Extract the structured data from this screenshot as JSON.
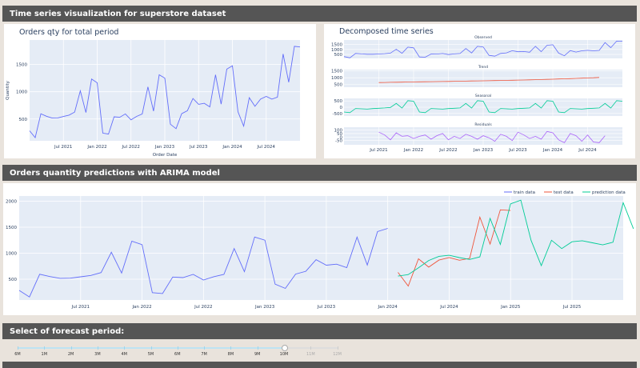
{
  "header1": {
    "title": "Time series visualization for superstore dataset"
  },
  "header2": {
    "title": "Orders quantity predictions with ARIMA model"
  },
  "header3": {
    "title": "Select of forecast period:"
  },
  "colors": {
    "header_bg": "#555555",
    "plot_bg": "#e5ecf6",
    "train": "#636efa",
    "test": "#ef553b",
    "prediction": "#00cc96",
    "trend": "#ef553b",
    "seasonal": "#00cc96",
    "resid": "#ab63fa"
  },
  "slider": {
    "options": [
      "6M",
      "1M",
      "2M",
      "3M",
      "4M",
      "5M",
      "6M",
      "7M",
      "8M",
      "9M",
      "10M",
      "11M",
      "12M"
    ],
    "selected": "10M"
  },
  "chart_data": [
    {
      "type": "line",
      "title": "Orders qty for total period",
      "xlabel": "Order Date",
      "ylabel": "Quantity",
      "x_ticks": [
        "Jul 2021",
        "Jan 2022",
        "Jul 2022",
        "Jan 2023",
        "Jul 2023",
        "Jan 2024",
        "Jul 2024"
      ],
      "y_ticks": [
        500,
        1000,
        1500
      ],
      "ylim": [
        100,
        1950
      ],
      "x_start": "2021-01",
      "x_end": "2024-12",
      "series": [
        {
          "values": [
            284,
            159,
            596,
            551,
            517,
            520,
            546,
            572,
            627,
            1018,
            618,
            1233,
            1165,
            241,
            224,
            541,
            531,
            593,
            485,
            548,
            593,
            1089,
            645,
            1311,
            1251,
            404,
            323,
            598,
            652,
            876,
            769,
            789,
            723,
            1311,
            773,
            1416,
            1477,
            631,
            368,
            892,
            733,
            867,
            915,
            865,
            901,
            1694,
            1175,
            1834,
            1822
          ]
        }
      ]
    },
    {
      "type": "line",
      "title": "Decomposed time series",
      "x_ticks": [
        "Jul 2021",
        "Jan 2022",
        "Jul 2022",
        "Jan 2023",
        "Jul 2023",
        "Jan 2024",
        "Jul 2024"
      ],
      "subplots": [
        {
          "title": "Observed",
          "y_ticks": [
            500,
            1000,
            1500
          ],
          "ylim": [
            100,
            1950
          ],
          "values": [
            284,
            159,
            596,
            551,
            517,
            520,
            546,
            572,
            627,
            1018,
            618,
            1233,
            1165,
            241,
            224,
            541,
            531,
            593,
            485,
            548,
            593,
            1089,
            645,
            1311,
            1251,
            404,
            323,
            598,
            652,
            876,
            769,
            789,
            723,
            1311,
            773,
            1416,
            1477,
            631,
            368,
            892,
            733,
            867,
            915,
            865,
            901,
            1694,
            1175,
            1834,
            1822
          ]
        },
        {
          "title": "Trend",
          "y_ticks": [
            500,
            1000,
            1500
          ],
          "ylim": [
            300,
            1600
          ],
          "values": [
            null,
            null,
            null,
            null,
            null,
            null,
            640,
            650,
            660,
            668,
            675,
            682,
            690,
            695,
            700,
            708,
            714,
            720,
            728,
            735,
            742,
            750,
            758,
            765,
            772,
            780,
            788,
            797,
            806,
            815,
            824,
            834,
            845,
            856,
            867,
            880,
            893,
            906,
            920,
            935,
            950,
            966,
            983,
            1000,
            1020,
            null,
            null,
            null,
            null
          ]
        },
        {
          "title": "Seasonal",
          "y_ticks": [
            -500,
            0,
            500
          ],
          "ylim": [
            -700,
            700
          ],
          "values": [
            -380,
            -430,
            -100,
            -130,
            -150,
            -110,
            -80,
            -60,
            -20,
            300,
            -70,
            520,
            480,
            -380,
            -430,
            -100,
            -130,
            -150,
            -110,
            -80,
            -60,
            300,
            -70,
            520,
            480,
            -380,
            -430,
            -100,
            -130,
            -150,
            -110,
            -80,
            -60,
            300,
            -70,
            520,
            480,
            -380,
            -430,
            -100,
            -130,
            -150,
            -110,
            -80,
            -60,
            300,
            -70,
            520,
            480
          ]
        },
        {
          "title": "Residuals",
          "y_ticks": [
            -50,
            0,
            50,
            100
          ],
          "ylim": [
            -110,
            140
          ],
          "values": [
            null,
            null,
            null,
            null,
            null,
            null,
            70,
            30,
            -40,
            60,
            10,
            20,
            -20,
            10,
            30,
            -30,
            20,
            50,
            -40,
            10,
            -20,
            40,
            10,
            -30,
            20,
            -10,
            -60,
            40,
            10,
            -50,
            70,
            30,
            -20,
            10,
            -30,
            80,
            60,
            -40,
            -80,
            50,
            20,
            -60,
            30,
            -70,
            -80,
            20,
            null,
            null,
            null
          ]
        }
      ]
    },
    {
      "type": "line",
      "x_ticks": [
        "Jul 2021",
        "Jan 2022",
        "Jul 2022",
        "Jan 2023",
        "Jul 2023",
        "Jan 2024",
        "Jul 2024",
        "Jan 2025",
        "Jul 2025"
      ],
      "y_ticks": [
        500,
        1000,
        1500,
        2000
      ],
      "ylim": [
        100,
        2100
      ],
      "legend": "top-right",
      "series": [
        {
          "name": "train data",
          "values": [
            284,
            159,
            596,
            551,
            517,
            520,
            546,
            572,
            627,
            1018,
            618,
            1233,
            1165,
            241,
            224,
            541,
            531,
            593,
            485,
            548,
            593,
            1089,
            645,
            1311,
            1251,
            404,
            323,
            598,
            652,
            876,
            769,
            789,
            723,
            1311,
            773,
            1416,
            1477
          ]
        },
        {
          "name": "test data",
          "values": [
            631,
            368,
            892,
            733,
            867,
            915,
            865,
            901,
            1694,
            1175,
            1834,
            1822
          ]
        },
        {
          "name": "prediction data",
          "values": [
            560,
            590,
            720,
            860,
            940,
            960,
            915,
            880,
            930,
            1670,
            1170,
            1950,
            2020,
            1250,
            760,
            1250,
            1090,
            1220,
            1240,
            1200,
            1160,
            1210,
            1970,
            1470
          ]
        }
      ]
    }
  ]
}
